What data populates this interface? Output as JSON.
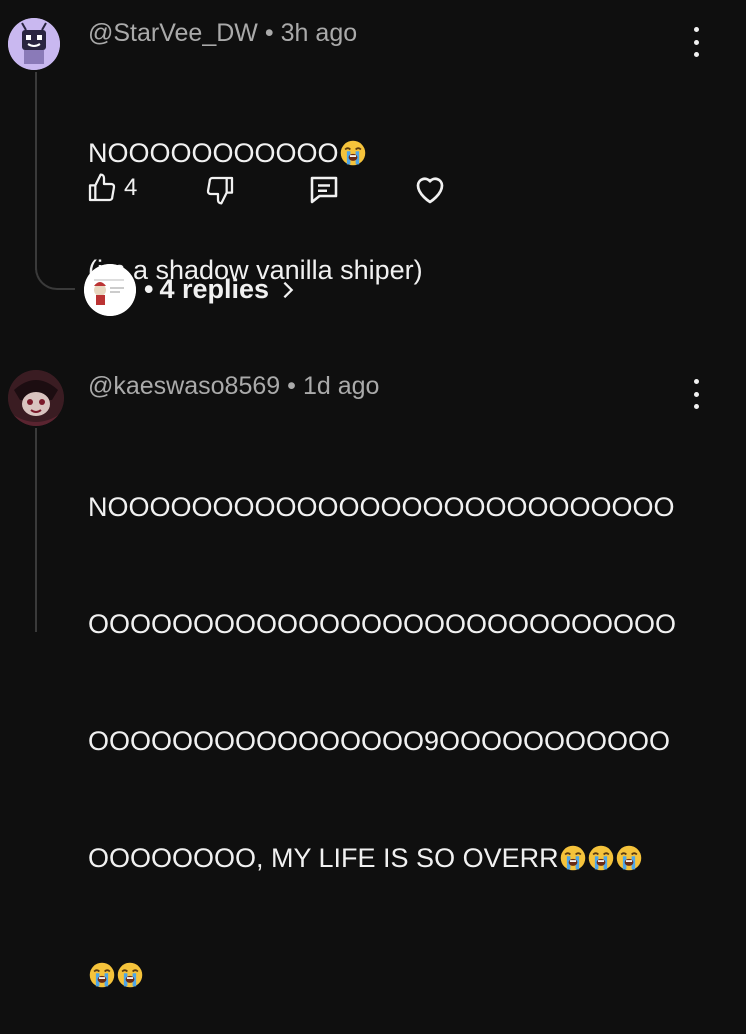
{
  "comments": [
    {
      "author": "@StarVee_DW",
      "separator": "•",
      "time": "3h ago",
      "lines": [
        "NOOOOOOOOOOO",
        "(im a shadow vanilla shiper)"
      ],
      "likes": "4"
    },
    {
      "author": "@kaeswaso8569",
      "separator": "•",
      "time": "1d ago",
      "lines": [
        "NOOOOOOOOOOOOOOOOOOOOOOOOOOO",
        "OOOOOOOOOOOOOOOOOOOOOOOOOOOO",
        "OOOOOOOOOOOOOOOO9OOOOOOOOOOO",
        "OOOOOOOO, MY LIFE IS SO OVERR"
      ]
    }
  ],
  "replies": {
    "separator": "•",
    "label": "4 replies",
    "chevron": "›"
  },
  "icons": [
    "kebab-menu-icon",
    "thumbs-up-icon",
    "thumbs-down-icon",
    "reply-comment-icon",
    "heart-icon",
    "loudly-crying-emoji",
    "chevron-right-icon"
  ],
  "colors": {
    "background": "#0f0f0f",
    "text": "#f1f1f1",
    "meta": "#aaaaaa",
    "thread": "#3a3a3a",
    "emoji": "#f5c33b"
  }
}
